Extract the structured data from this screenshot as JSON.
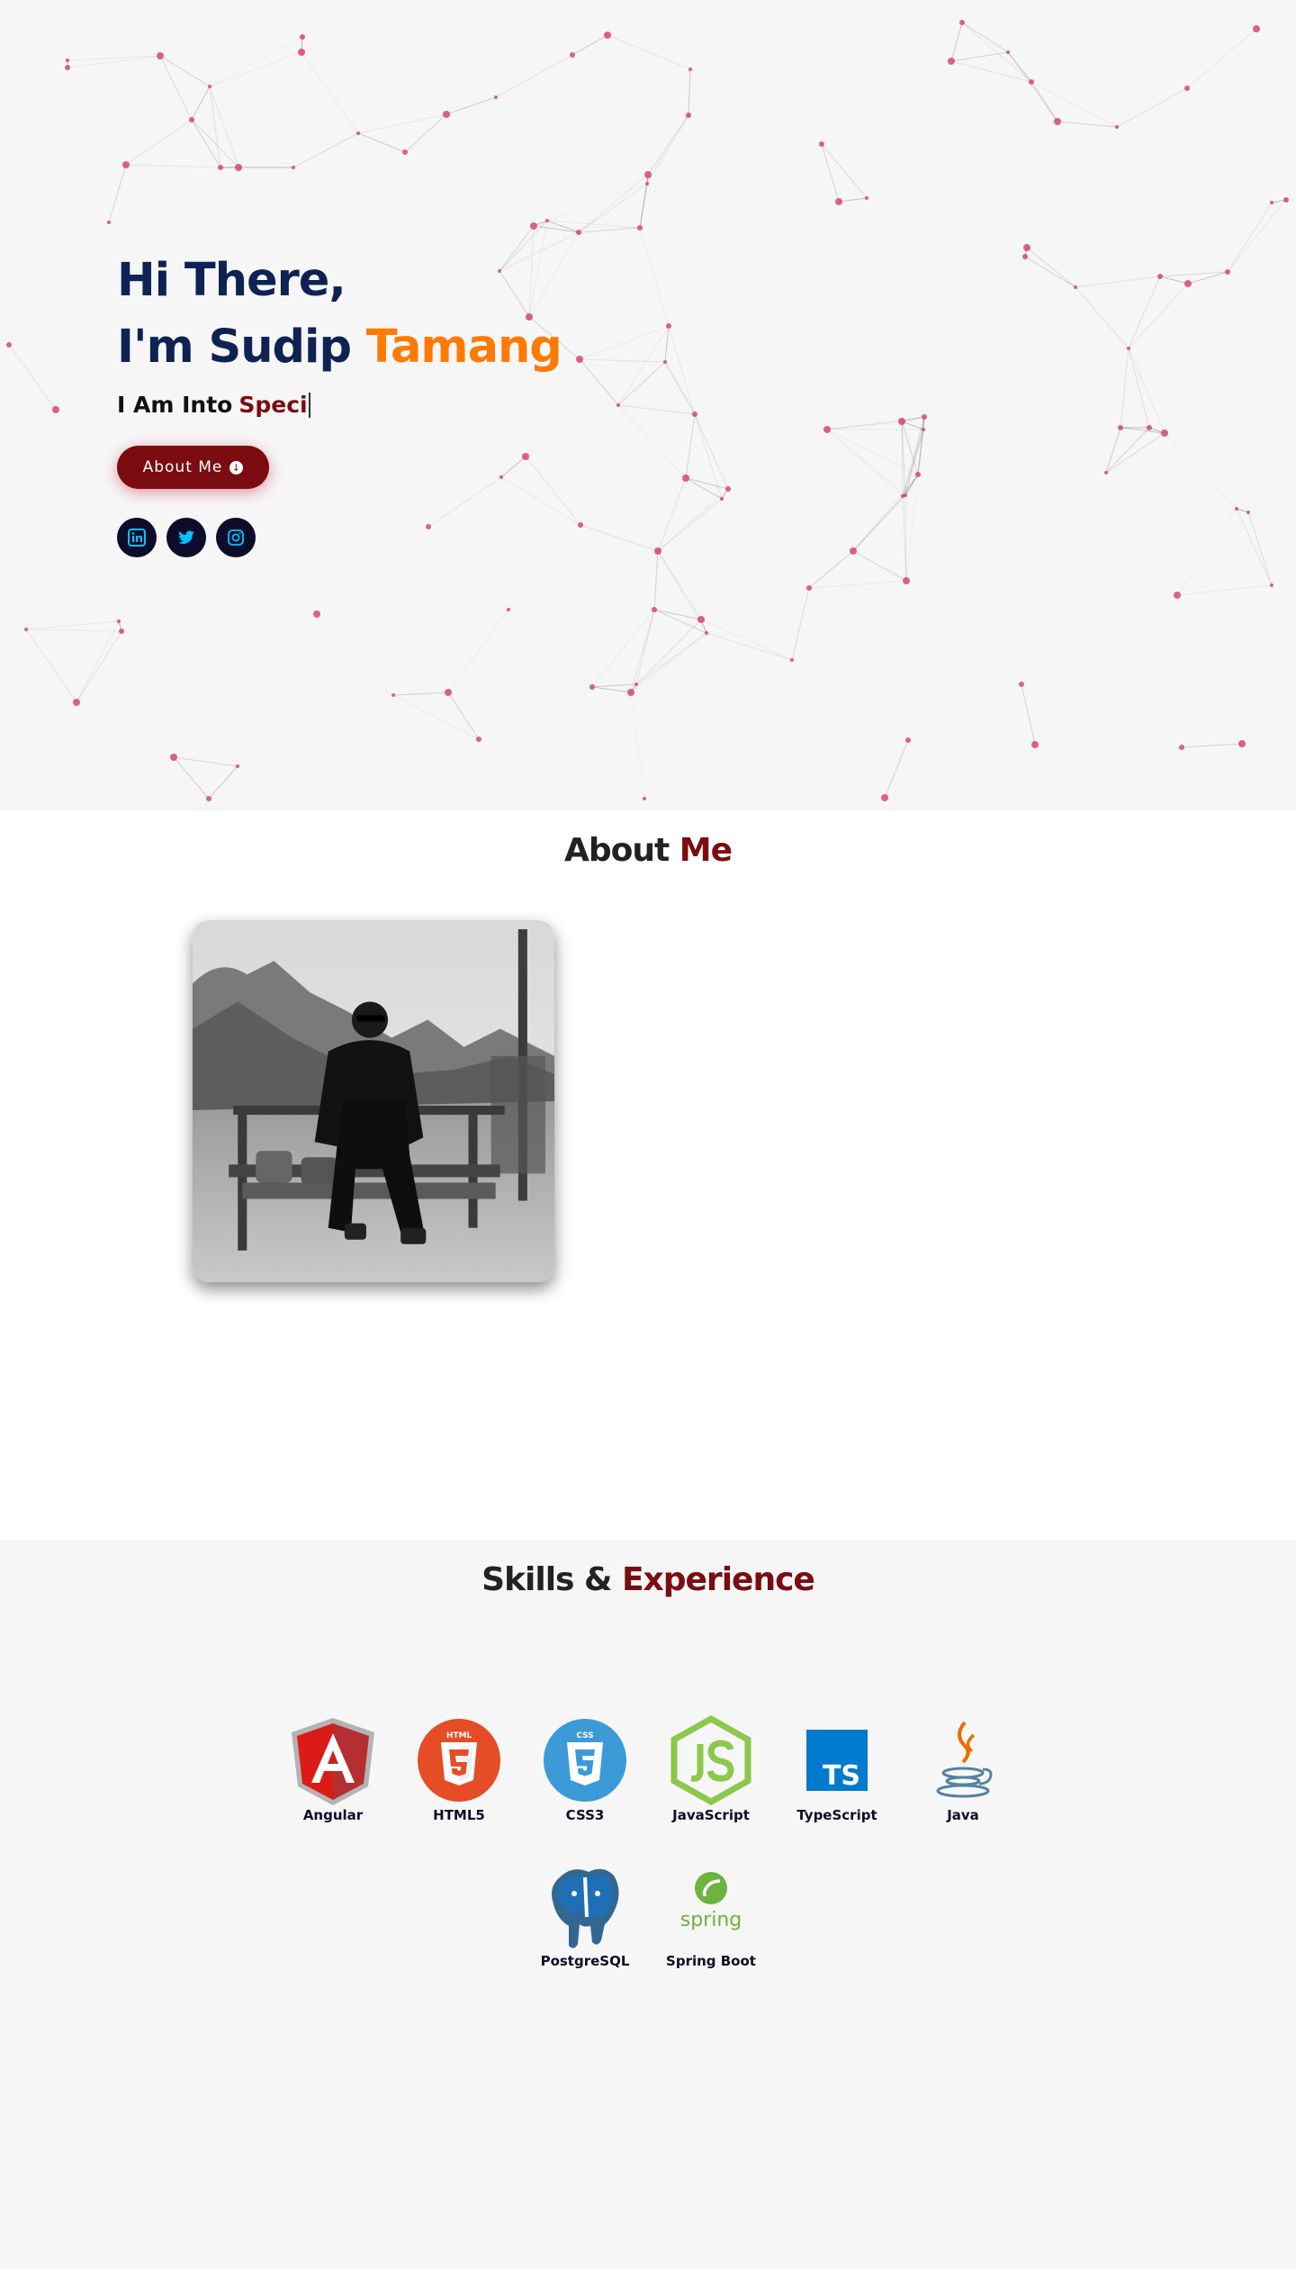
{
  "hero": {
    "greeting": "Hi There,",
    "intro": "I'm Sudip",
    "surname": "Tamang",
    "subtitle_prefix": "I Am Into",
    "subtitle_typed": "Speci",
    "button_label": "About Me",
    "socials": [
      {
        "name": "linkedin",
        "icon": "linkedin-icon"
      },
      {
        "name": "twitter",
        "icon": "twitter-icon"
      },
      {
        "name": "instagram",
        "icon": "instagram-icon"
      }
    ]
  },
  "about": {
    "title_prefix": "About",
    "title_highlight": "Me",
    "photo_alt": "profile-photo"
  },
  "skills": {
    "title_prefix": "Skills &",
    "title_highlight": "Experience",
    "items": [
      {
        "label": "Angular",
        "icon": "angular-icon"
      },
      {
        "label": "HTML5",
        "icon": "html5-icon"
      },
      {
        "label": "CSS3",
        "icon": "css3-icon"
      },
      {
        "label": "JavaScript",
        "icon": "nodejs-icon"
      },
      {
        "label": "TypeScript",
        "icon": "typescript-icon"
      },
      {
        "label": "Java",
        "icon": "java-icon"
      },
      {
        "label": "PostgreSQL",
        "icon": "postgresql-icon"
      },
      {
        "label": "Spring Boot",
        "icon": "spring-icon"
      }
    ]
  },
  "colors": {
    "navy": "#0e2353",
    "orange": "#ff7a00",
    "maroon": "#7b0c12",
    "particle": "#d9466a",
    "social_bg": "#0d0d2b",
    "social_icon": "#00c2ff"
  }
}
